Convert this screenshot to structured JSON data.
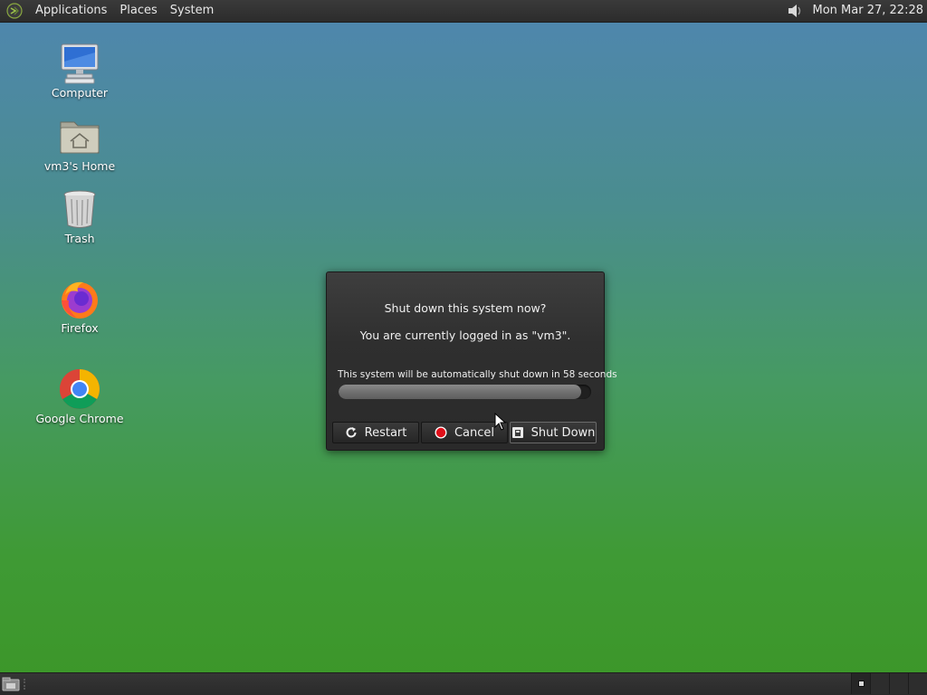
{
  "top_panel": {
    "menus": [
      "Applications",
      "Places",
      "System"
    ],
    "clock": "Mon Mar 27, 22:28",
    "sound_icon": "speaker-icon"
  },
  "desktop_icons": [
    {
      "label": "Computer",
      "icon": "computer-icon"
    },
    {
      "label": "vm3's Home",
      "icon": "home-folder-icon"
    },
    {
      "label": "Trash",
      "icon": "trash-icon"
    },
    {
      "label": "Firefox",
      "icon": "firefox-icon"
    },
    {
      "label": "Google Chrome",
      "icon": "chrome-icon"
    }
  ],
  "dialog": {
    "title": "Shut down this system now?",
    "subtitle": "You are currently logged in as \"vm3\".",
    "countdown_text": "This system will be automatically shut down in 58 seconds",
    "progress_fraction": 0.96,
    "buttons": {
      "restart": "Restart",
      "cancel": "Cancel",
      "shutdown": "Shut Down"
    }
  },
  "colors": {
    "panel": "#2e2e2e",
    "dialog": "#2f2f2f",
    "cancel_icon": "#e0101a"
  }
}
